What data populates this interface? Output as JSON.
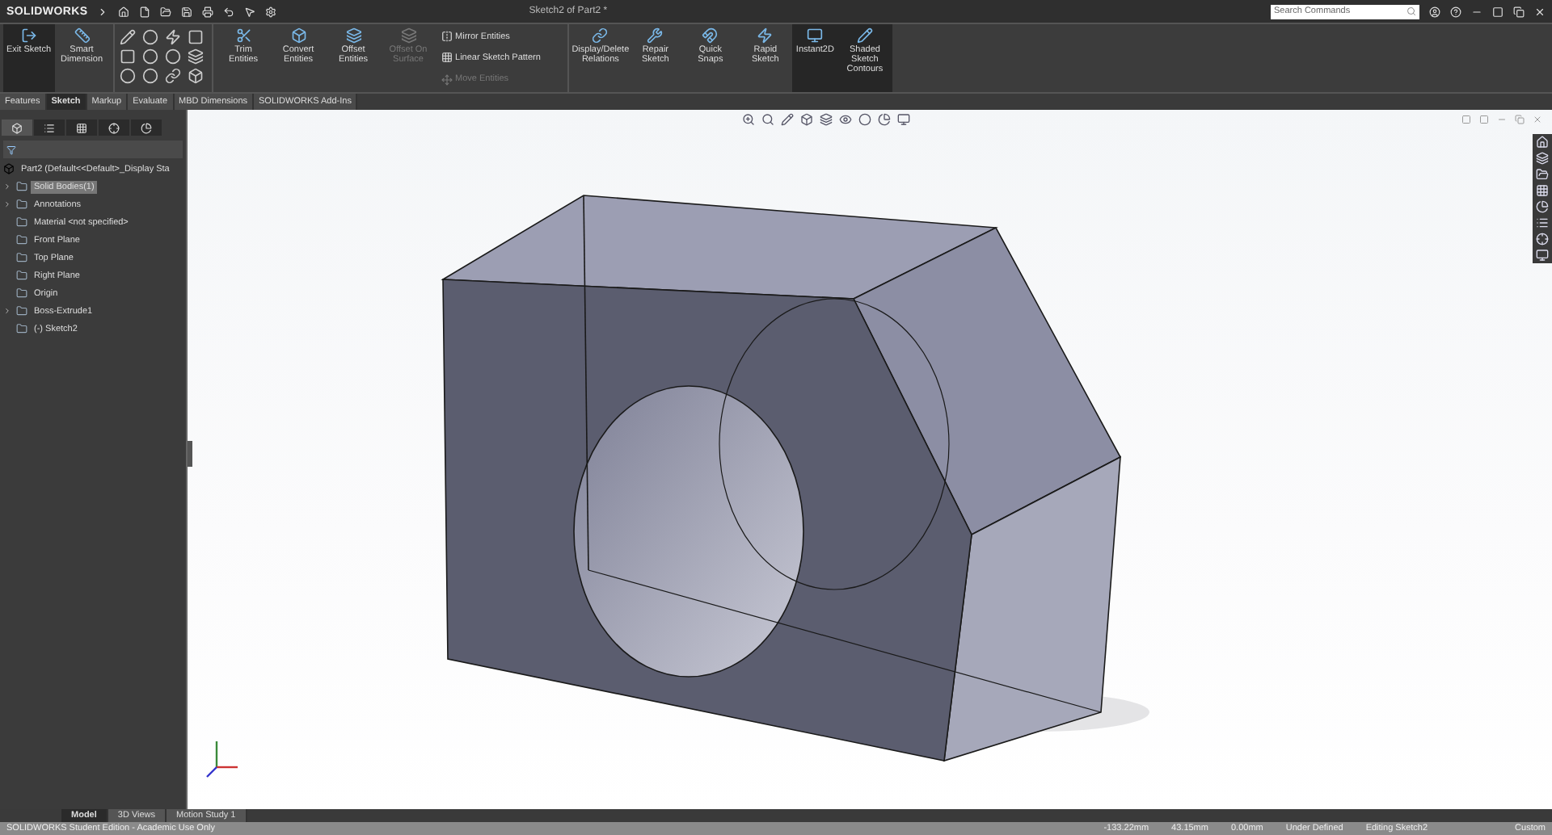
{
  "app": {
    "logo_text": "SOLIDWORKS",
    "title": "Sketch2 of Part2 *",
    "search": {
      "placeholder": "Search Commands"
    }
  },
  "ribbon": [
    {
      "kind": "large",
      "label": "Exit Sketch",
      "selected": true,
      "disabled": false
    },
    {
      "kind": "large",
      "label": "Smart Dimension",
      "selected": false,
      "disabled": false
    },
    {
      "kind": "tools"
    },
    {
      "kind": "large",
      "label": "Trim Entities",
      "selected": false,
      "disabled": false
    },
    {
      "kind": "large",
      "label": "Convert Entities",
      "selected": false,
      "disabled": false
    },
    {
      "kind": "large",
      "label": "Offset Entities",
      "selected": false,
      "disabled": false
    },
    {
      "kind": "large",
      "label": "Offset On Surface",
      "selected": false,
      "disabled": true
    },
    {
      "kind": "stack",
      "items": [
        {
          "label": "Mirror Entities",
          "disabled": false
        },
        {
          "label": "Linear Sketch Pattern",
          "disabled": false
        },
        {
          "label": "Move Entities",
          "disabled": true
        }
      ]
    },
    {
      "kind": "large",
      "label": "Display/Delete Relations",
      "selected": false,
      "disabled": false
    },
    {
      "kind": "large",
      "label": "Repair Sketch",
      "selected": false,
      "disabled": false
    },
    {
      "kind": "large",
      "label": "Quick Snaps",
      "selected": false,
      "disabled": false
    },
    {
      "kind": "large",
      "label": "Rapid Sketch",
      "selected": false,
      "disabled": false
    },
    {
      "kind": "large",
      "label": "Instant2D",
      "selected": true,
      "disabled": false
    },
    {
      "kind": "large",
      "label": "Shaded Sketch Contours",
      "selected": true,
      "disabled": false
    }
  ],
  "tabs": [
    {
      "label": "Features",
      "selected": false
    },
    {
      "label": "Sketch",
      "selected": true
    },
    {
      "label": "Markup",
      "selected": false
    },
    {
      "label": "Evaluate",
      "selected": false
    },
    {
      "label": "MBD Dimensions",
      "selected": false
    },
    {
      "label": "SOLIDWORKS Add-Ins",
      "selected": false
    }
  ],
  "tree": {
    "root": "Part2  (Default<<Default>_Display Sta",
    "items": [
      {
        "label": "Solid Bodies(1)",
        "expandable": true,
        "selected": true
      },
      {
        "label": "Annotations",
        "expandable": true,
        "selected": false
      },
      {
        "label": "Material <not specified>",
        "expandable": false,
        "selected": false
      },
      {
        "label": "Front Plane",
        "expandable": false,
        "selected": false
      },
      {
        "label": "Top Plane",
        "expandable": false,
        "selected": false
      },
      {
        "label": "Right Plane",
        "expandable": false,
        "selected": false
      },
      {
        "label": "Origin",
        "expandable": false,
        "selected": false
      },
      {
        "label": "Boss-Extrude1",
        "expandable": true,
        "selected": false
      },
      {
        "label": "(-) Sketch2",
        "expandable": false,
        "selected": false
      }
    ]
  },
  "bottom_tabs": [
    {
      "label": "Model",
      "selected": true
    },
    {
      "label": "3D Views",
      "selected": false
    },
    {
      "label": "Motion Study 1",
      "selected": false
    }
  ],
  "status_bar": {
    "edition": "SOLIDWORKS Student Edition - Academic Use Only",
    "x": "-133.22mm",
    "y": "43.15mm",
    "z": "0.00mm",
    "state": "Under Defined",
    "mode": "Editing Sketch2",
    "units": "Custom"
  }
}
